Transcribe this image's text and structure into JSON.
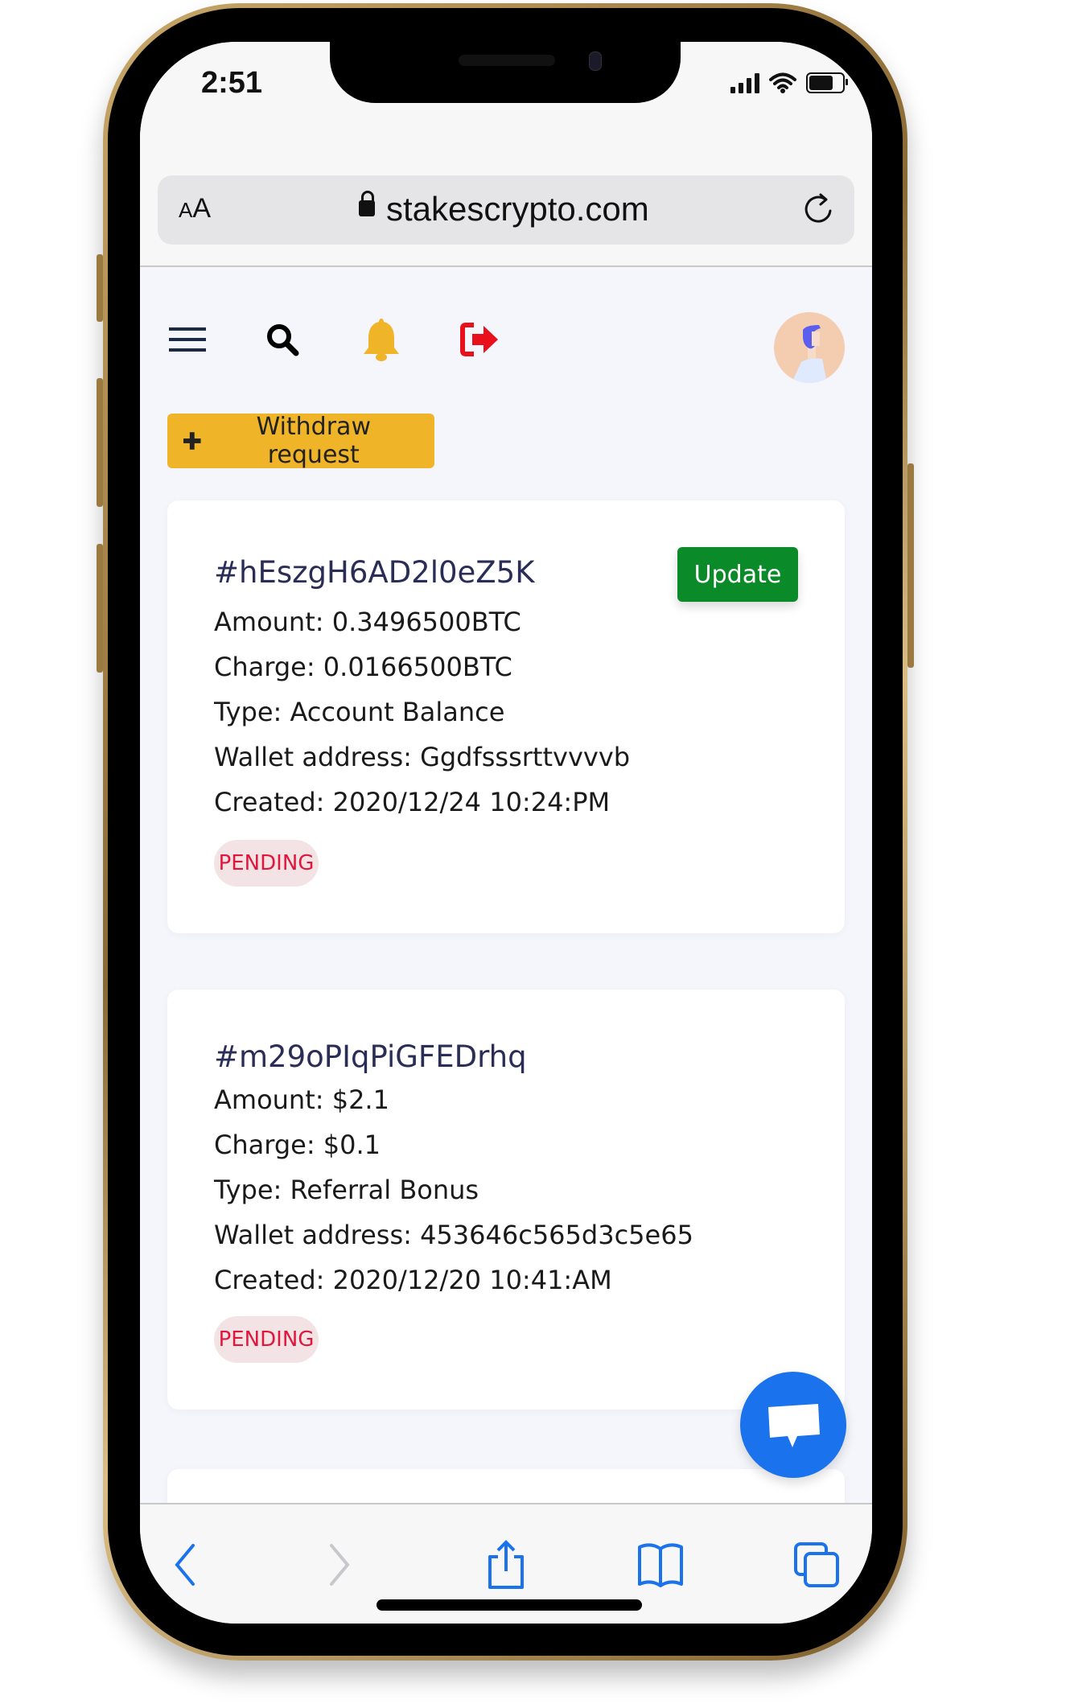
{
  "status_bar": {
    "time": "2:51",
    "battery_level": 0.8
  },
  "browser": {
    "text_size_label_small": "A",
    "text_size_label_large": "A",
    "url": "stakescrypto.com"
  },
  "nav": {
    "icons": [
      "menu-icon",
      "search-icon",
      "bell-icon",
      "logout-icon"
    ],
    "colors": {
      "bell": "#f0b429",
      "logout": "#e8101a",
      "menu": "#1b2a44"
    }
  },
  "actions": {
    "withdraw_label": "Withdraw request",
    "withdraw_color": "#f0b429"
  },
  "withdrawals": [
    {
      "id": "#hEszgH6AD2l0eZ5K",
      "amount": "Amount: 0.3496500BTC",
      "charge": "Charge: 0.0166500BTC",
      "type": "Type: Account Balance",
      "wallet": "Wallet address: Ggdfsssrttvvvvb",
      "created": "Created: 2020/12/24 10:24:PM",
      "status": "PENDING",
      "update_label": "Update"
    },
    {
      "id": "#m29oPIqPiGFEDrhq",
      "amount": "Amount: $2.1",
      "charge": "Charge: $0.1",
      "type": "Type: Referral Bonus",
      "wallet": "Wallet address: 453646c565d3c5e65",
      "created": "Created: 2020/12/20 10:41:AM",
      "status": "PENDING"
    }
  ],
  "colors": {
    "update": "#0b8a2a",
    "pending_text": "#e0173d",
    "pending_bg": "#f3e3e4",
    "chat": "#1a73ec",
    "ios_blue": "#1a73ec"
  }
}
